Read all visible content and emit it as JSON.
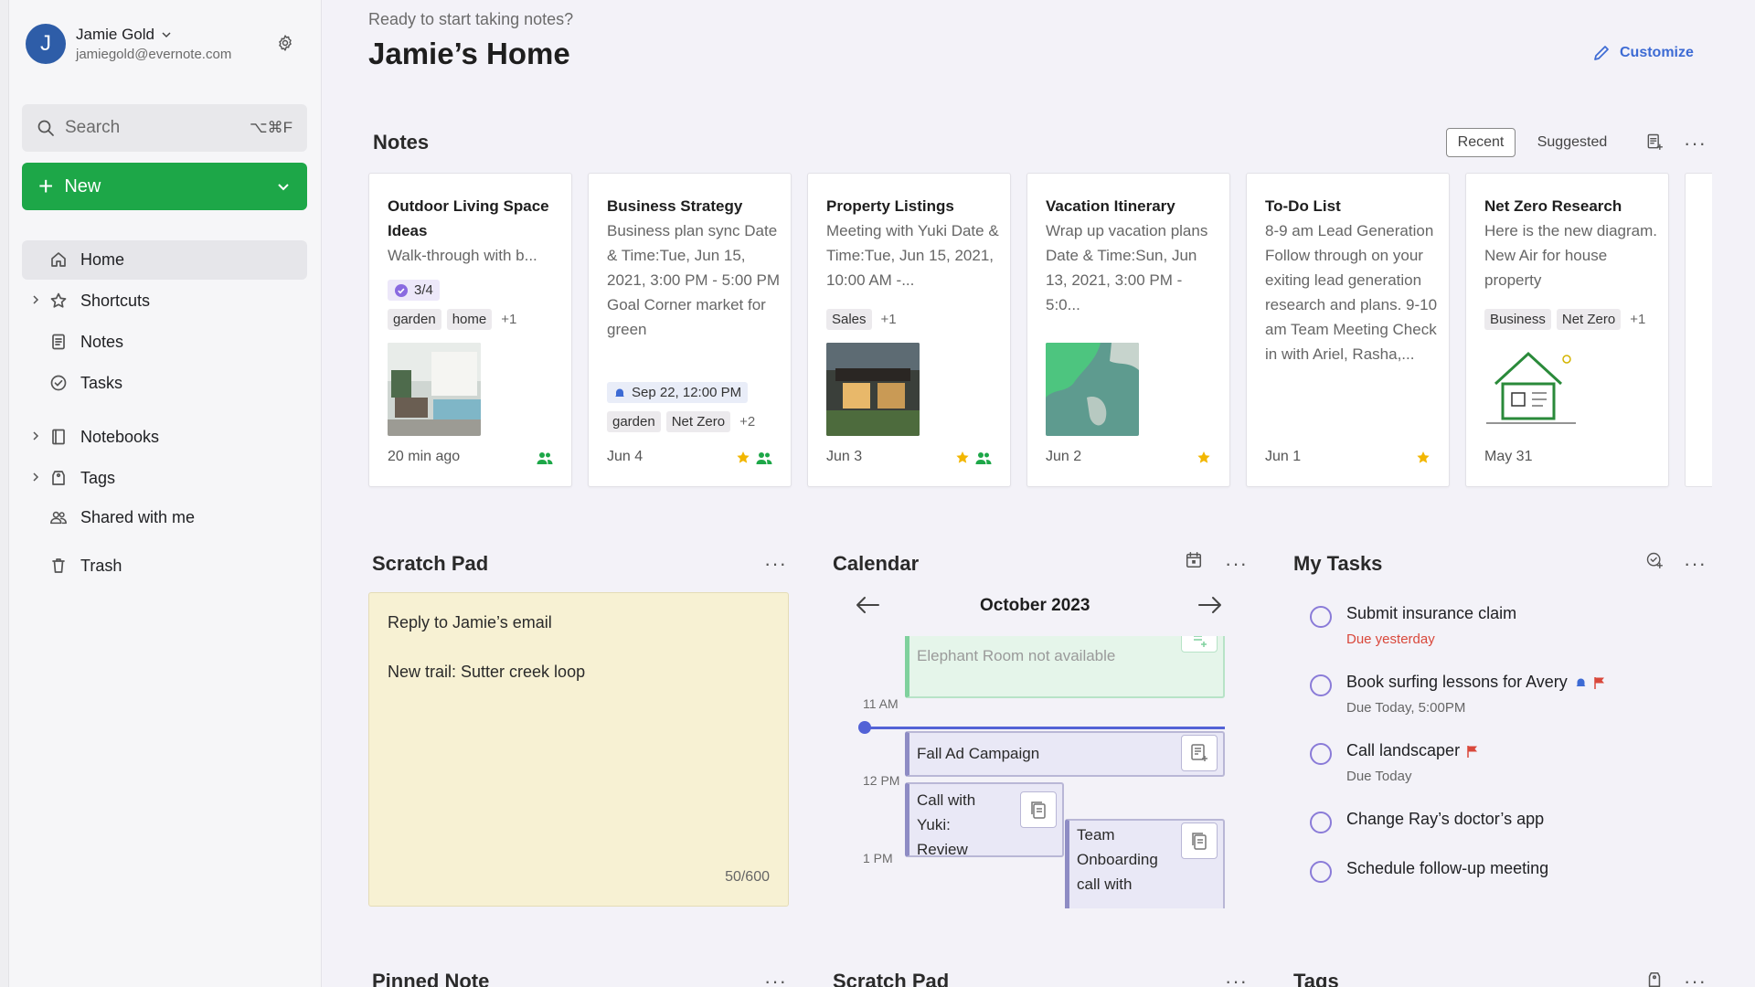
{
  "account": {
    "initial": "J",
    "name": "Jamie Gold",
    "email": "jamiegold@evernote.com"
  },
  "search": {
    "placeholder": "Search",
    "shortcut": "⌥⌘F"
  },
  "new_button": {
    "label": "New"
  },
  "nav": [
    {
      "label": "Home",
      "icon": "home-icon",
      "active": true
    },
    {
      "label": "Shortcuts",
      "icon": "star-icon"
    },
    {
      "label": "Notes",
      "icon": "note-icon"
    },
    {
      "label": "Tasks",
      "icon": "check-circle-icon"
    },
    {
      "label": "Notebooks",
      "icon": "notebook-icon"
    },
    {
      "label": "Tags",
      "icon": "tag-icon"
    },
    {
      "label": "Shared with me",
      "icon": "people-icon"
    },
    {
      "label": "Trash",
      "icon": "trash-icon"
    }
  ],
  "header": {
    "greeting": "Ready to start taking notes?",
    "title": "Jamie’s Home",
    "customize": "Customize"
  },
  "notes": {
    "title": "Notes",
    "tabs": [
      "Recent",
      "Suggested"
    ],
    "cards": [
      {
        "title": "Outdoor Living Space Ideas",
        "snippet": "Walk-through with b...",
        "badge": "3/4",
        "tags": [
          "garden",
          "home"
        ],
        "more": "+1",
        "date": "20 min ago"
      },
      {
        "title": "Business Strategy",
        "snippet": "Business plan sync Date & Time:Tue, Jun 15, 2021, 3:00 PM - 5:00 PM Goal Corner market for green",
        "reminder": "Sep 22, 12:00 PM",
        "tags": [
          "garden",
          "Net Zero"
        ],
        "more": "+2",
        "date": "Jun 4"
      },
      {
        "title": "Property Listings",
        "snippet": "Meeting with Yuki Date & Time:Tue, Jun 15, 2021, 10:00 AM -...",
        "tags": [
          "Sales"
        ],
        "more": "+1",
        "date": "Jun 3"
      },
      {
        "title": "Vacation Itinerary",
        "snippet": "Wrap up vacation plans Date & Time:Sun, Jun 13, 2021, 3:00 PM - 5:0...",
        "date": "Jun 2"
      },
      {
        "title": "To-Do List",
        "snippet": "8-9 am Lead Generation Follow through on your exiting lead generation research and plans. 9-10 am Team Meeting Check in with Ariel, Rasha,...",
        "date": "Jun 1"
      },
      {
        "title": "Net Zero Research",
        "snippet": "Here is the new diagram. New Air for house property",
        "tags": [
          "Business",
          "Net Zero"
        ],
        "more": "+1",
        "date": "May 31"
      }
    ]
  },
  "scratch_pad": {
    "title": "Scratch Pad",
    "lines": [
      "Reply to Jamie’s email",
      "New trail: Sutter creek loop"
    ],
    "count": "50/600"
  },
  "calendar": {
    "title": "Calendar",
    "month": "October 2023",
    "times": [
      "11 AM",
      "12 PM",
      "1 PM"
    ],
    "events": [
      "Elephant Room not available",
      "Fall Ad Campaign",
      "Call with Yuki: Review",
      "Team Onboarding call with"
    ]
  },
  "tasks": {
    "title": "My Tasks",
    "items": [
      {
        "title": "Submit insurance claim",
        "due": "Due yesterday"
      },
      {
        "title": "Book surfing lessons for Avery",
        "due": "Due Today, 5:00PM"
      },
      {
        "title": "Call landscaper",
        "due": "Due Today"
      },
      {
        "title": "Change Ray’s doctor’s app"
      },
      {
        "title": "Schedule follow-up meeting"
      }
    ]
  },
  "bottom_sections": [
    "Pinned Note",
    "Scratch Pad",
    "Tags"
  ],
  "colors": {
    "accent_green": "#1da748",
    "link_blue": "#3d6bd4",
    "task_purple": "#8a7bd8",
    "overdue_red": "#d9483b"
  }
}
